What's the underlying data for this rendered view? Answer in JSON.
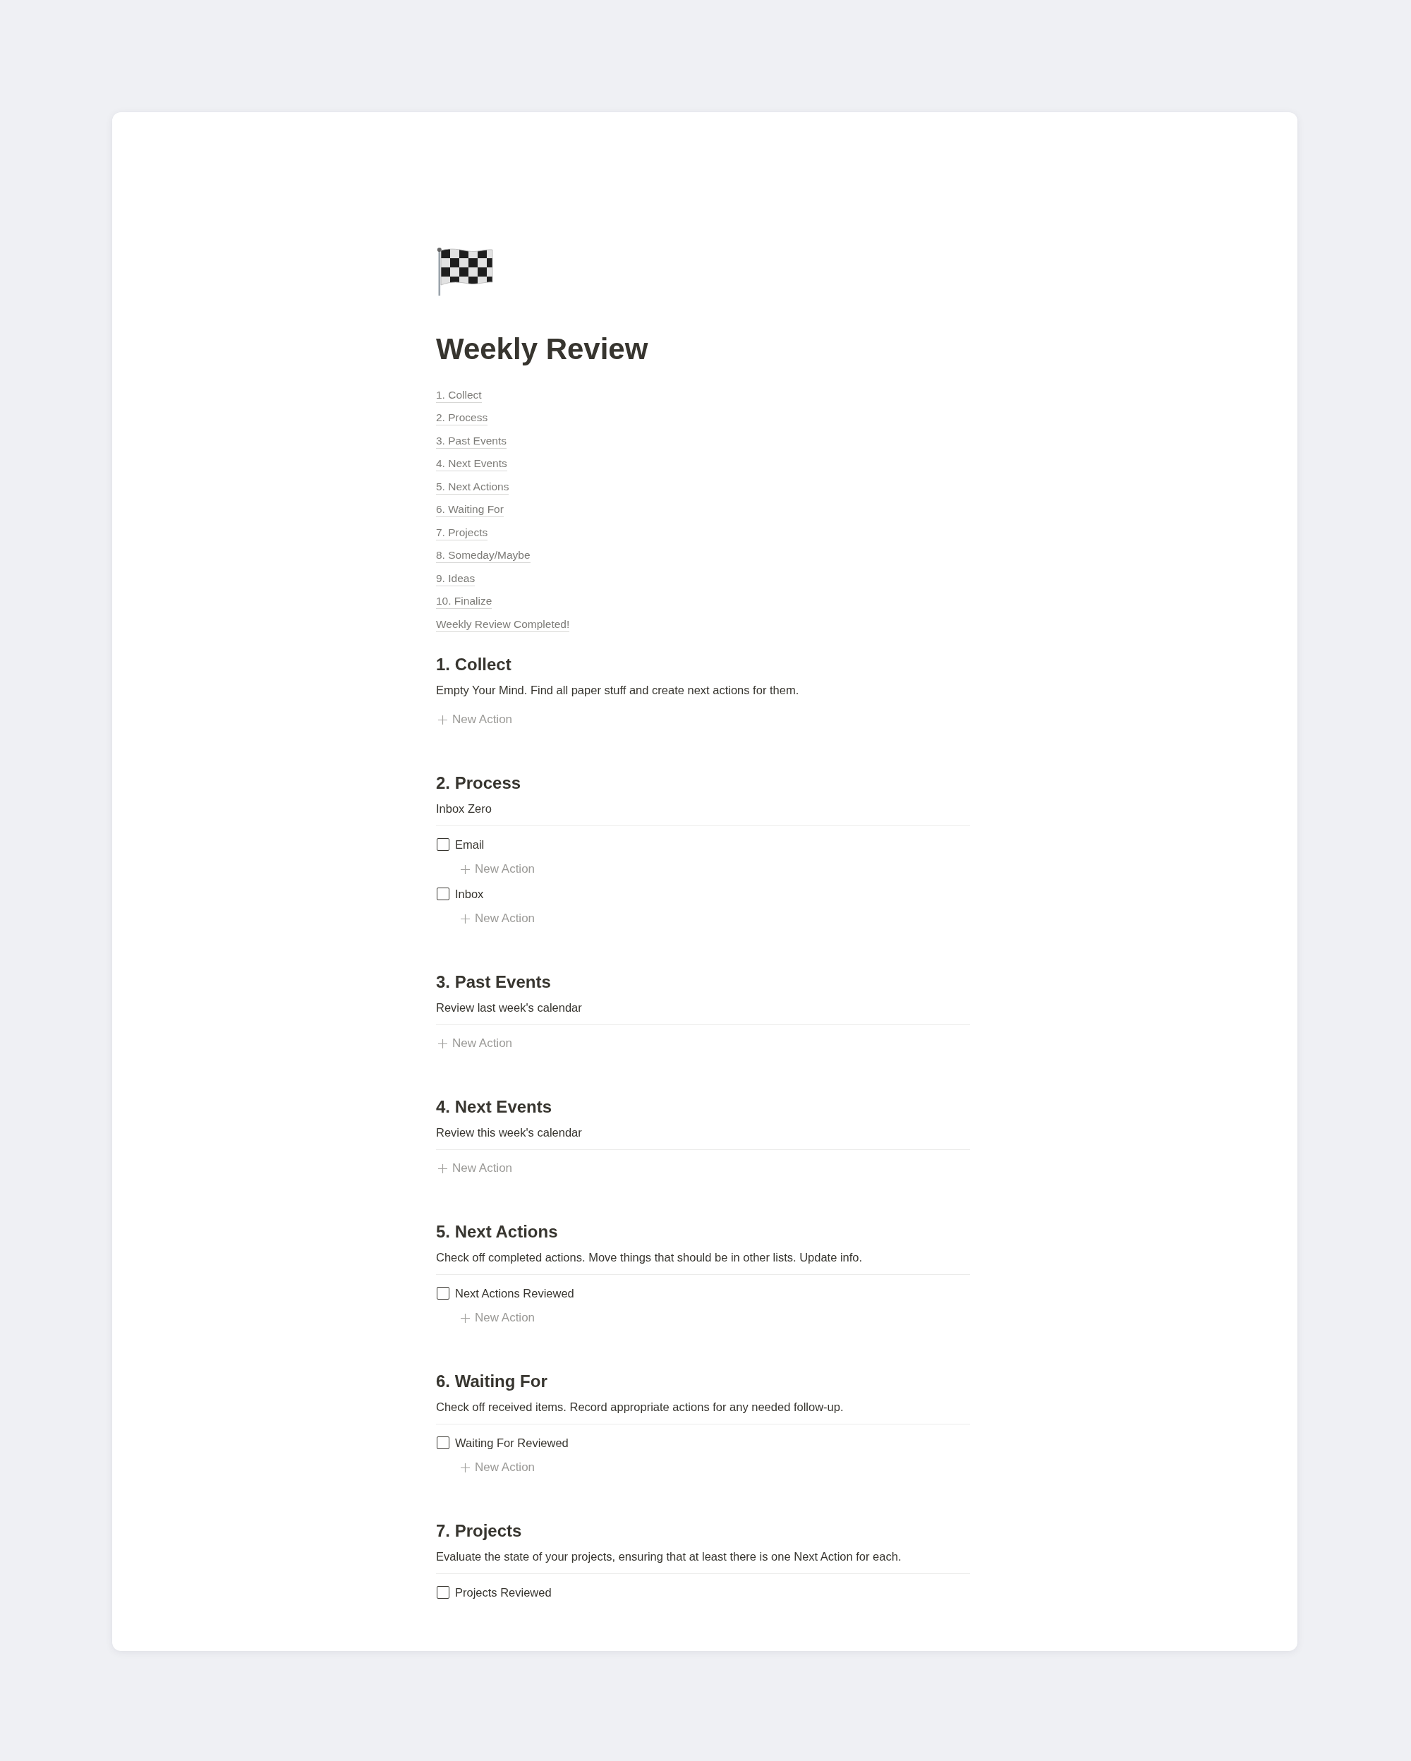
{
  "page": {
    "title": "Weekly Review"
  },
  "table_of_contents": [
    "1. Collect",
    "2. Process",
    "3. Past Events",
    "4. Next Events",
    "5. Next Actions",
    "6. Waiting For",
    "7. Projects",
    "8. Someday/Maybe",
    "9. Ideas",
    "10. Finalize",
    "Weekly Review Completed!"
  ],
  "sections": [
    {
      "heading": "1. Collect",
      "description": "Empty Your Mind. Find all paper stuff and create next actions for them.",
      "divider": false,
      "items": [
        {
          "kind": "new_action",
          "label": "New Action"
        }
      ]
    },
    {
      "heading": "2. Process",
      "description": "Inbox Zero",
      "divider": true,
      "items": [
        {
          "kind": "task",
          "label": "Email",
          "checked": false,
          "children": [
            {
              "kind": "new_action",
              "label": "New Action"
            }
          ]
        },
        {
          "kind": "task",
          "label": "Inbox",
          "checked": false,
          "children": [
            {
              "kind": "new_action",
              "label": "New Action"
            }
          ]
        }
      ]
    },
    {
      "heading": "3. Past Events",
      "description": "Review last week's calendar",
      "divider": true,
      "items": [
        {
          "kind": "new_action",
          "label": "New Action"
        }
      ]
    },
    {
      "heading": "4. Next Events",
      "description": "Review this week's calendar",
      "divider": true,
      "items": [
        {
          "kind": "new_action",
          "label": "New Action"
        }
      ]
    },
    {
      "heading": "5. Next Actions",
      "description": "Check off completed actions. Move things that should be in other lists. Update info.",
      "divider": true,
      "items": [
        {
          "kind": "task",
          "label": "Next Actions Reviewed",
          "checked": false,
          "children": [
            {
              "kind": "new_action",
              "label": "New Action"
            }
          ]
        }
      ]
    },
    {
      "heading": "6. Waiting For",
      "description": "Check off received items. Record appropriate actions for any needed follow-up.",
      "divider": true,
      "items": [
        {
          "kind": "task",
          "label": "Waiting For Reviewed",
          "checked": false,
          "children": [
            {
              "kind": "new_action",
              "label": "New Action"
            }
          ]
        }
      ]
    },
    {
      "heading": "7. Projects",
      "description": "Evaluate the state of your projects, ensuring that at least there is one Next Action for each.",
      "divider": true,
      "items": [
        {
          "kind": "task",
          "label": "Projects Reviewed",
          "checked": false
        }
      ]
    }
  ]
}
